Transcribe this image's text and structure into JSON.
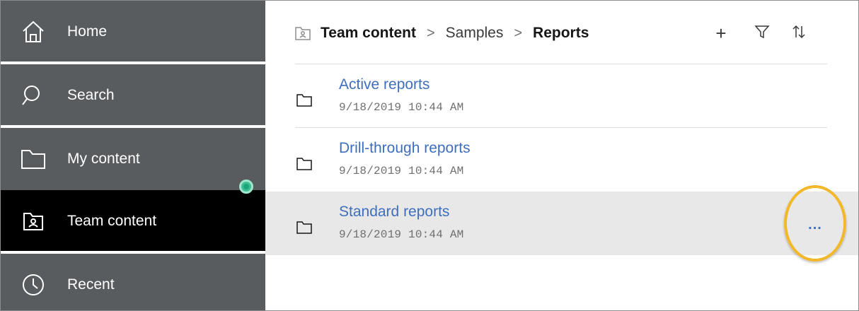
{
  "sidebar": {
    "items": [
      {
        "label": "Home",
        "icon": "home-icon"
      },
      {
        "label": "Search",
        "icon": "search-icon"
      },
      {
        "label": "My content",
        "icon": "folder-icon"
      },
      {
        "label": "Team content",
        "icon": "team-folder-icon",
        "active": true
      },
      {
        "label": "Recent",
        "icon": "clock-icon"
      }
    ],
    "notification_color": "#3fbf93"
  },
  "breadcrumb": {
    "items": [
      "Team content",
      "Samples",
      "Reports"
    ],
    "separator": ">"
  },
  "toolbar": {
    "add": "+",
    "filter_icon": "filter-icon",
    "sort_icon": "sort-icon"
  },
  "list": {
    "rows": [
      {
        "title": "Active reports",
        "date": "9/18/2019 10:44 AM"
      },
      {
        "title": "Drill-through reports",
        "date": "9/18/2019 10:44 AM"
      },
      {
        "title": "Standard reports",
        "date": "9/18/2019 10:44 AM",
        "selected": true,
        "more": "..."
      }
    ]
  },
  "colors": {
    "sidebar_bg": "#585c5f",
    "active_bg": "#000000",
    "link": "#3d6fbd",
    "highlight_ring": "#f2b82a",
    "selected_row": "#e8e8e8"
  }
}
